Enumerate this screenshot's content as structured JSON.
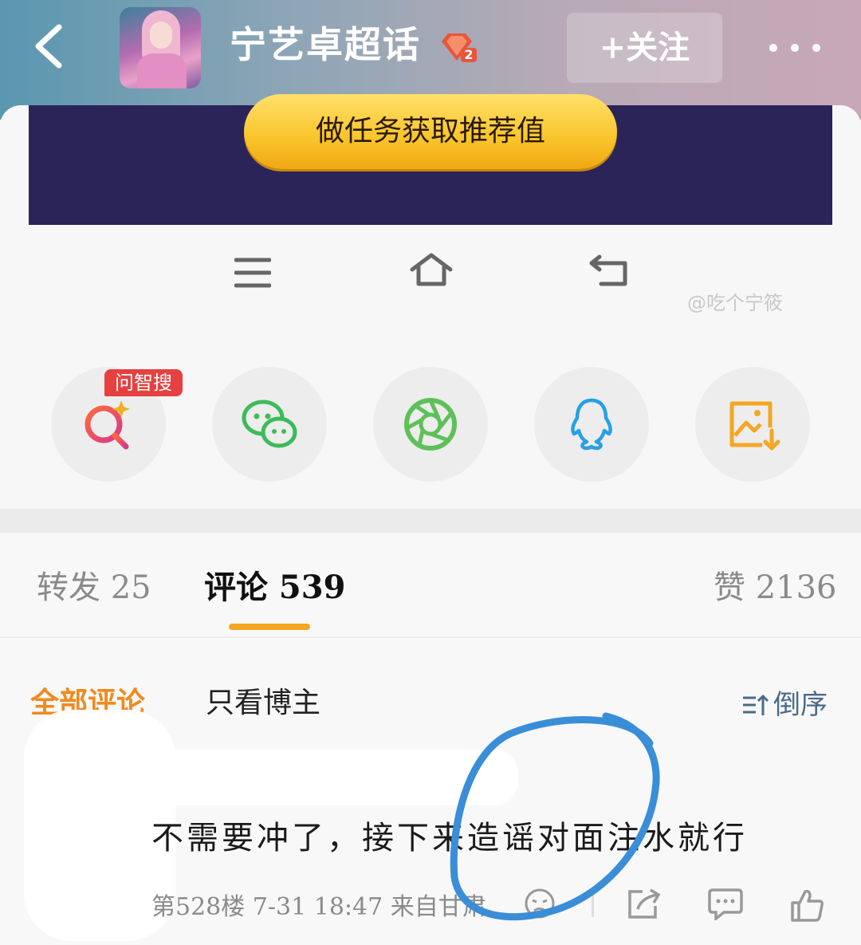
{
  "header": {
    "title": "宁艺卓超话",
    "level_badge": "2",
    "follow_label": "+关注"
  },
  "banner": {
    "task_button": "做任务获取推荐值"
  },
  "watermark": "@吃个宁筱",
  "share": {
    "ai_search_tag": "问智搜",
    "items": [
      "ai-search",
      "wechat",
      "moments",
      "qq",
      "save-image"
    ]
  },
  "tabs": {
    "forward": "转发 25",
    "comments": "评论 539",
    "likes": "赞 2136",
    "active": "comments"
  },
  "filters": {
    "all": "全部评论",
    "op_only": "只看博主",
    "sort": "倒序"
  },
  "comment": {
    "text": "不需要冲了，接下来造谣对面注水就行",
    "meta": "第528楼 7-31 18:47 来自甘肃"
  },
  "colors": {
    "accent_orange": "#f5a623",
    "banner_navy": "#2a2459",
    "annotation_blue": "#3a8ed8"
  }
}
